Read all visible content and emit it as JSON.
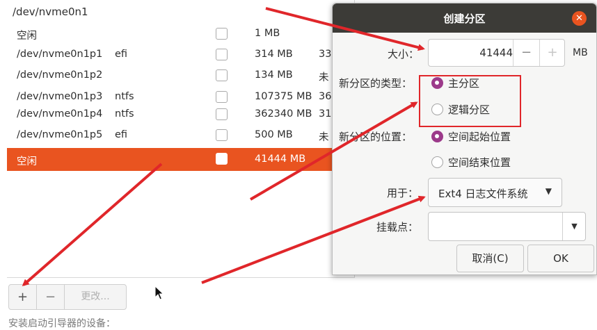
{
  "table": {
    "device": "/dev/nvme0n1",
    "rows": [
      {
        "name": "空闲",
        "fs": "",
        "size": "1 MB",
        "used": "",
        "selected": false
      },
      {
        "name": "/dev/nvme0n1p1",
        "fs": "efi",
        "size": "314 MB",
        "used": "33",
        "selected": false
      },
      {
        "name": "/dev/nvme0n1p2",
        "fs": "",
        "size": "134 MB",
        "used": "未",
        "selected": false
      },
      {
        "name": "/dev/nvme0n1p3",
        "fs": "ntfs",
        "size": "107375 MB",
        "used": "36",
        "selected": false
      },
      {
        "name": "/dev/nvme0n1p4",
        "fs": "ntfs",
        "size": "362340 MB",
        "used": "31",
        "selected": false
      },
      {
        "name": "/dev/nvme0n1p5",
        "fs": "efi",
        "size": "500 MB",
        "used": "未",
        "selected": false
      },
      {
        "name": "空闲",
        "fs": "",
        "size": "41444 MB",
        "used": "",
        "selected": true
      }
    ]
  },
  "toolbar": {
    "add": "+",
    "remove": "−",
    "change": "更改..."
  },
  "bootloader_label": "安装启动引导器的设备：",
  "dialog": {
    "title": "创建分区",
    "close": "✕",
    "size_label": "大小：",
    "size_value": "41444",
    "minus": "−",
    "plus": "+",
    "unit": "MB",
    "type_label": "新分区的类型：",
    "type_options": [
      {
        "label": "主分区",
        "checked": true
      },
      {
        "label": "逻辑分区",
        "checked": false
      }
    ],
    "location_label": "新分区的位置：",
    "location_options": [
      {
        "label": "空间起始位置",
        "checked": true
      },
      {
        "label": "空间结束位置",
        "checked": false
      }
    ],
    "use_label": "用于：",
    "use_value": "Ext4 日志文件系统",
    "mount_label": "挂载点：",
    "mount_value": "",
    "cancel": "取消(C)",
    "ok": "OK"
  },
  "colors": {
    "accent": "#e95420",
    "annotation": "#e0262a",
    "radio": "#9c3a8a",
    "titlebar": "#3c3b37"
  }
}
